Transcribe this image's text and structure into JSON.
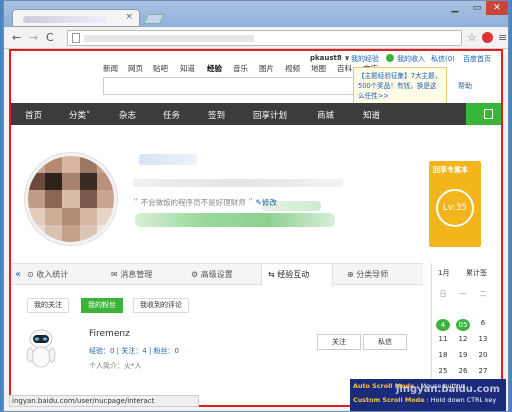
{
  "window": {
    "tab_close": "×",
    "minimize": "▁",
    "maximize": "▭",
    "close": "✕"
  },
  "toolbar": {
    "back": "←",
    "forward": "→",
    "reload": "C",
    "star": "☆",
    "menu": "≡"
  },
  "user_bar": {
    "username": "pkaust8 ∨",
    "my_exp": "我的经验",
    "my_income": "我的收入",
    "messages": "私信(0)",
    "home": "百度首页"
  },
  "site_nav": [
    "新闻",
    "网页",
    "贴吧",
    "知道",
    "经验",
    "音乐",
    "图片",
    "视频",
    "地图",
    "百科",
    "文库"
  ],
  "site_nav_current": "经验",
  "tooltip_text": "【主题经验征集】7大主题，500个奖品！有钱，换是这么任性>>",
  "help_link": "帮助",
  "main_nav": [
    "首页",
    "分类˅",
    "杂志",
    "任务",
    "签到",
    "回享计划",
    "商城",
    "知道"
  ],
  "profile": {
    "motto": "不会做饭的程序员不是好理财师",
    "edit": "修改",
    "level_title": "回享专属本",
    "level": "Lv:35"
  },
  "tabs": [
    "收入统计",
    "消息管理",
    "高级设置",
    "经验互动",
    "分类导师"
  ],
  "tabs_nav_arrow": "«",
  "active_tab": "经验互动",
  "sub_tabs": [
    "我的关注",
    "我的粉丝",
    "我收到的评论"
  ],
  "active_sub_tab": "我的粉丝",
  "fan": {
    "name": "Firemenz",
    "stats": "经验：0 | 关注：4 | 粉丝：0",
    "intro": "个人简介：火*人",
    "follow": "关注",
    "message": "私信"
  },
  "calendar": {
    "month": "1月",
    "total": "累计签",
    "weekdays": [
      "日",
      "一",
      "二"
    ],
    "days": [
      "4",
      "05",
      "6",
      "11",
      "12",
      "13",
      "18",
      "19",
      "20",
      "25",
      "26",
      "27"
    ]
  },
  "status_url": "ingyan.baidu.com/user/nucpage/interact",
  "extension": {
    "line1_key": "Auto Scroll Mode",
    "line1_val": ": Mouse button",
    "line2_key": "Custom Scroll Mode",
    "line2_val": ": Hold down CTRL key"
  },
  "watermark": "jingyan.baidu.com",
  "colors": {
    "accent_green": "#3ab53a",
    "highlight_red": "#e02020",
    "level_gold": "#f2b51b",
    "nav_dark": "#3c3c3c"
  }
}
